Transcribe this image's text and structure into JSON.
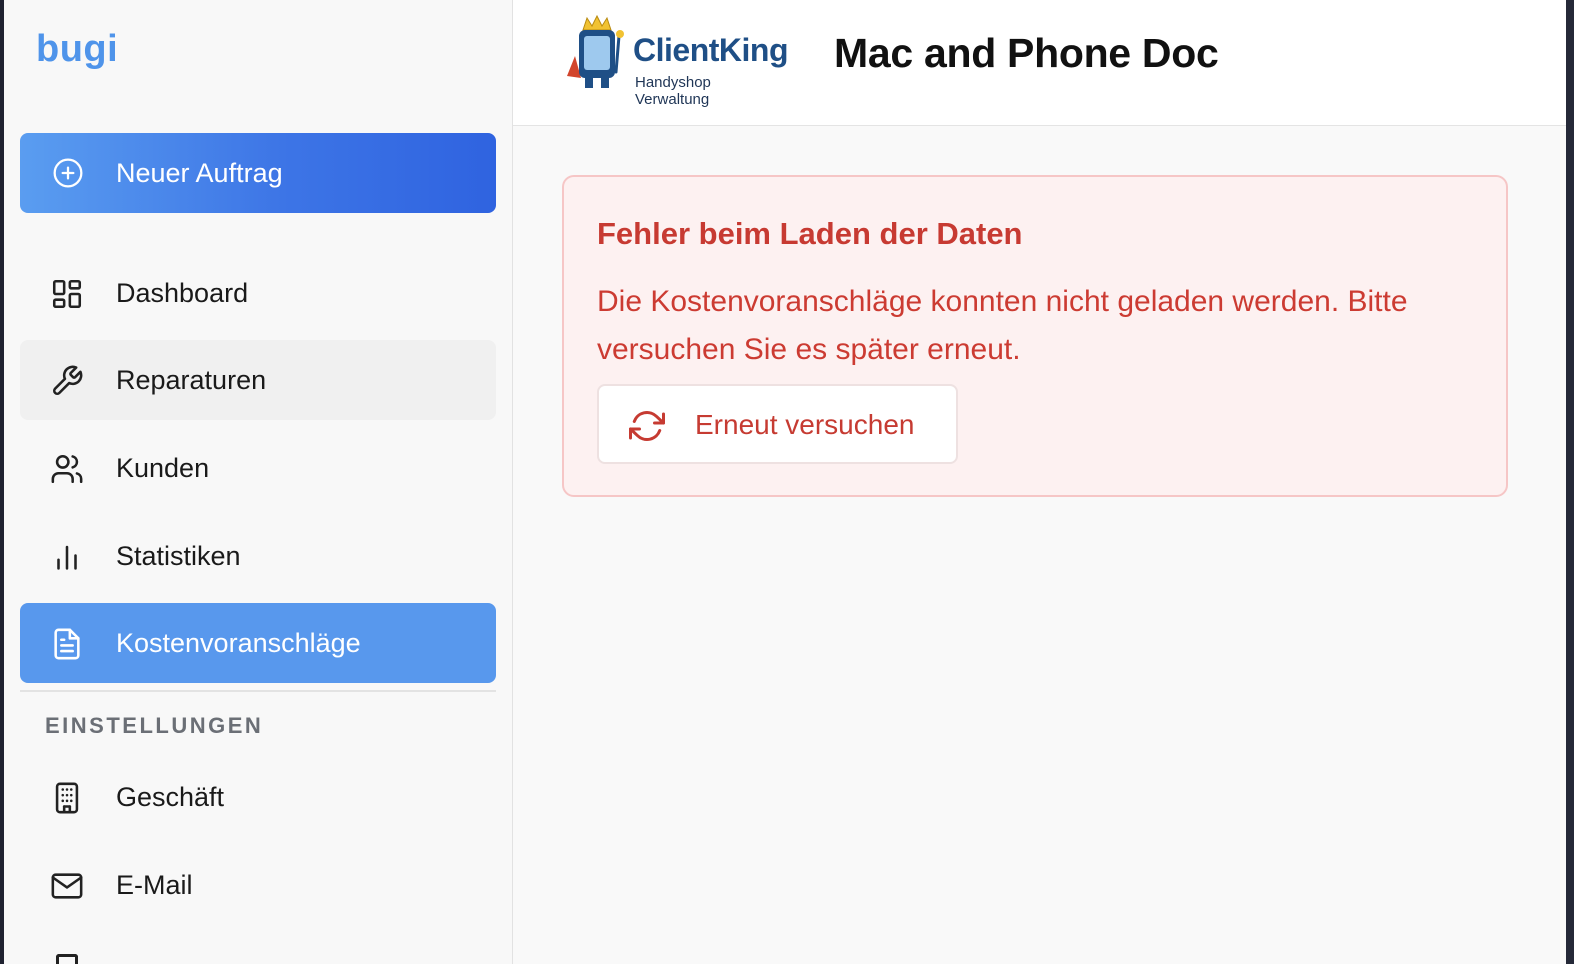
{
  "sidebar": {
    "brand": "bugi",
    "new_order_label": "Neuer Auftrag",
    "items": [
      {
        "label": "Dashboard",
        "icon": "dashboard-icon"
      },
      {
        "label": "Reparaturen",
        "icon": "wrench-icon"
      },
      {
        "label": "Kunden",
        "icon": "users-icon"
      },
      {
        "label": "Statistiken",
        "icon": "bar-chart-icon"
      },
      {
        "label": "Kostenvoranschläge",
        "icon": "document-icon",
        "active": true
      }
    ],
    "settings_title": "EINSTELLUNGEN",
    "settings_items": [
      {
        "label": "Geschäft",
        "icon": "building-icon"
      },
      {
        "label": "E-Mail",
        "icon": "mail-icon"
      }
    ]
  },
  "header": {
    "logo_name": "ClientKing",
    "logo_tagline": "Handyshop Verwaltung",
    "shop_name": "Mac and Phone Doc"
  },
  "error": {
    "title": "Fehler beim Laden der Daten",
    "message": "Die Kostenvoranschläge konnten nicht geladen werden. Bitte versuchen Sie es später erneut.",
    "retry_label": "Erneut versuchen"
  },
  "colors": {
    "accent": "#5898ed",
    "brand": "#4f94ea",
    "error_text": "#c73a32",
    "error_bg": "#fdf1f1"
  }
}
